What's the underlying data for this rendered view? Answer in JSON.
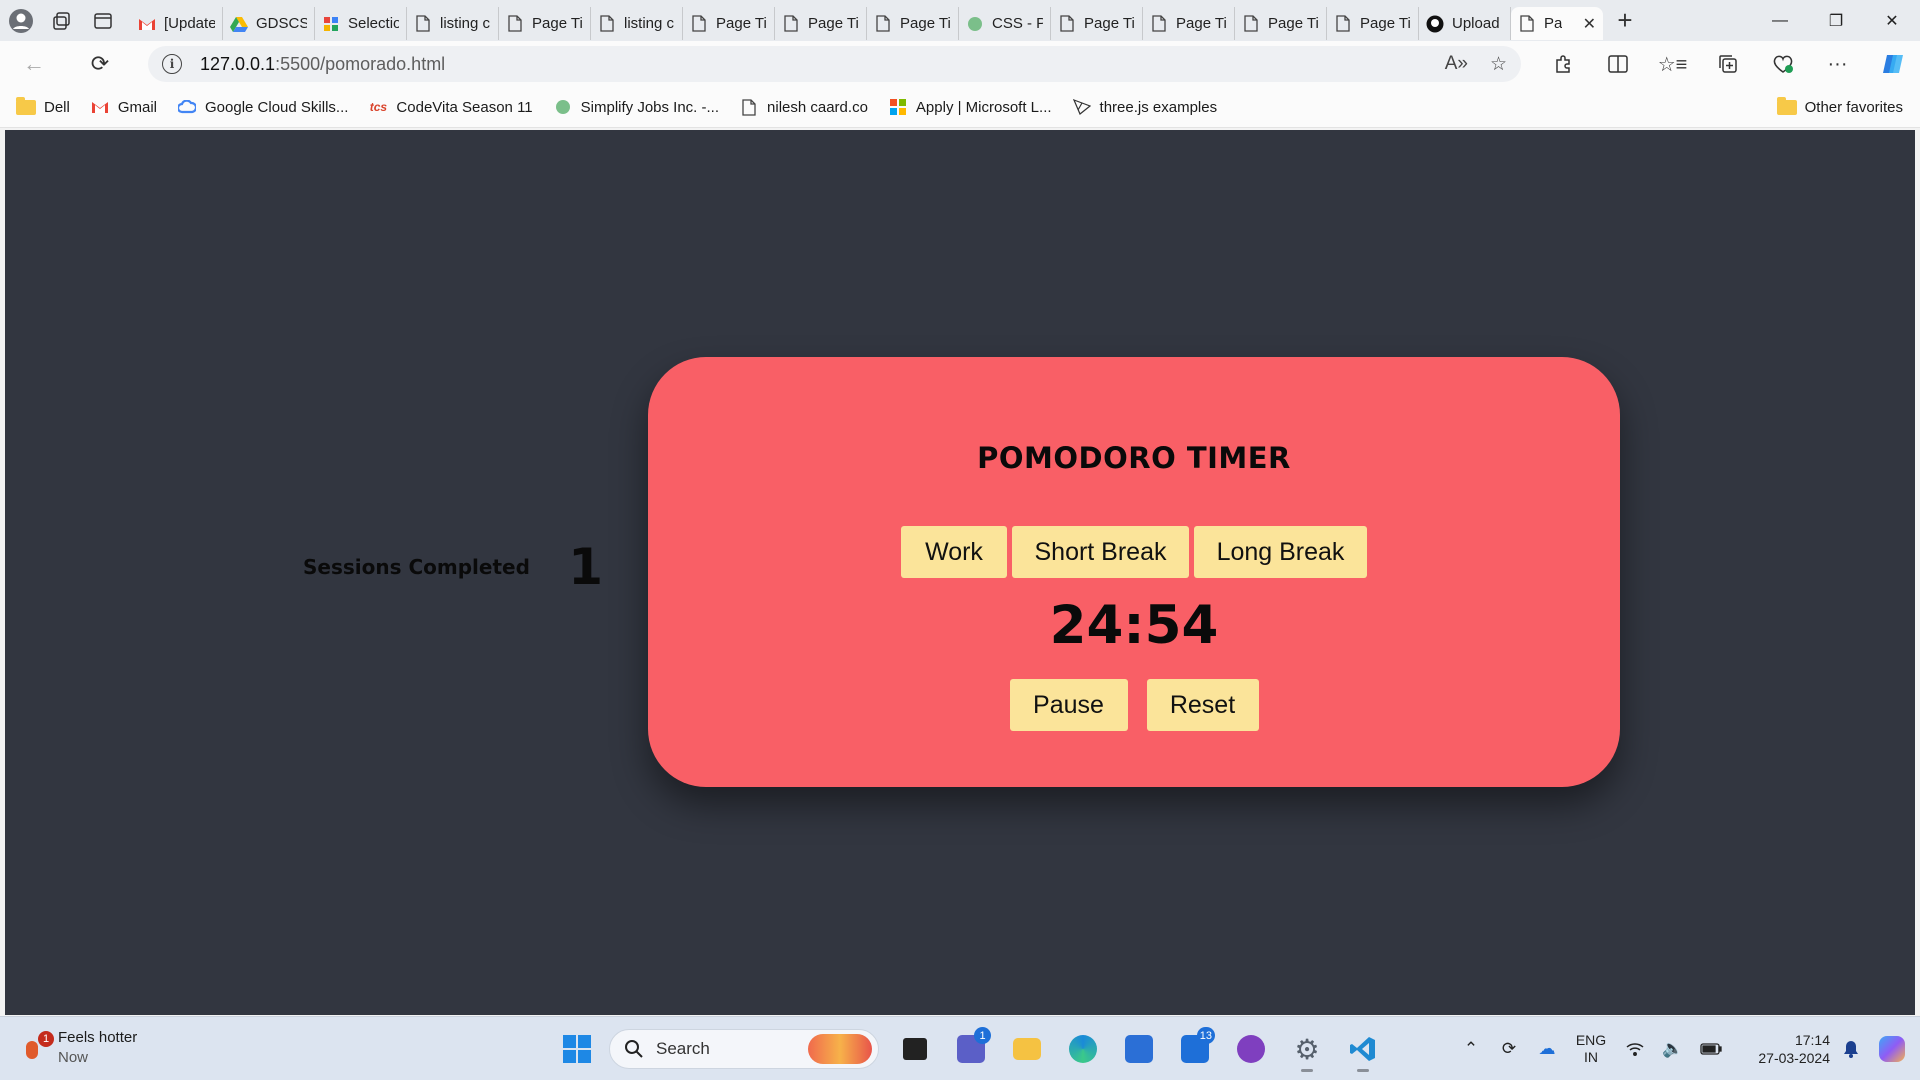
{
  "browser": {
    "tabs": [
      {
        "title": "[Update",
        "icon": "gmail-icon"
      },
      {
        "title": "GDSCS",
        "icon": "drive-icon"
      },
      {
        "title": "Selectio",
        "icon": "puzzle-icon"
      },
      {
        "title": "listing c",
        "icon": "page-icon"
      },
      {
        "title": "Page Ti",
        "icon": "page-icon"
      },
      {
        "title": "listing c",
        "icon": "page-icon"
      },
      {
        "title": "Page Ti",
        "icon": "page-icon"
      },
      {
        "title": "Page Ti",
        "icon": "page-icon"
      },
      {
        "title": "Page Ti",
        "icon": "page-icon"
      },
      {
        "title": "CSS - P",
        "icon": "globe-icon"
      },
      {
        "title": "Page Ti",
        "icon": "page-icon"
      },
      {
        "title": "Page Ti",
        "icon": "page-icon"
      },
      {
        "title": "Page Ti",
        "icon": "page-icon"
      },
      {
        "title": "Page Ti",
        "icon": "page-icon"
      },
      {
        "title": "Upload",
        "icon": "github-icon"
      }
    ],
    "active_tab": {
      "title": "Pa",
      "icon": "page-icon"
    },
    "url_host": "127.0.0.1",
    "url_path": ":5500/pomorado.html",
    "favorites": [
      {
        "label": "Dell",
        "icon": "folder-icon"
      },
      {
        "label": "Gmail",
        "icon": "gmail-icon"
      },
      {
        "label": "Google Cloud Skills...",
        "icon": "google-cloud-icon"
      },
      {
        "label": "CodeVita Season 11",
        "icon": "tcs-icon"
      },
      {
        "label": "Simplify Jobs Inc. -...",
        "icon": "globe-icon"
      },
      {
        "label": "nilesh caard.co",
        "icon": "page-icon"
      },
      {
        "label": "Apply | Microsoft L...",
        "icon": "microsoft-icon"
      },
      {
        "label": "three.js examples",
        "icon": "threejs-icon"
      }
    ],
    "other_favorites": "Other favorites"
  },
  "page": {
    "sessions_label": "Sessions Completed",
    "sessions_count": "1",
    "title": "POMODORO TIMER",
    "modes": [
      "Work",
      "Short Break",
      "Long Break"
    ],
    "time": "24:54",
    "pause_label": "Pause",
    "reset_label": "Reset",
    "colors": {
      "background": "#323640",
      "card": "#f95f66",
      "button": "#fbe49a"
    }
  },
  "taskbar": {
    "weather_title": "Feels hotter",
    "weather_sub": "Now",
    "weather_badge": "1",
    "search_placeholder": "Search",
    "teams_badge": "1",
    "mail_badge": "13",
    "lang_1": "ENG",
    "lang_2": "IN",
    "time": "17:14",
    "date": "27-03-2024"
  }
}
